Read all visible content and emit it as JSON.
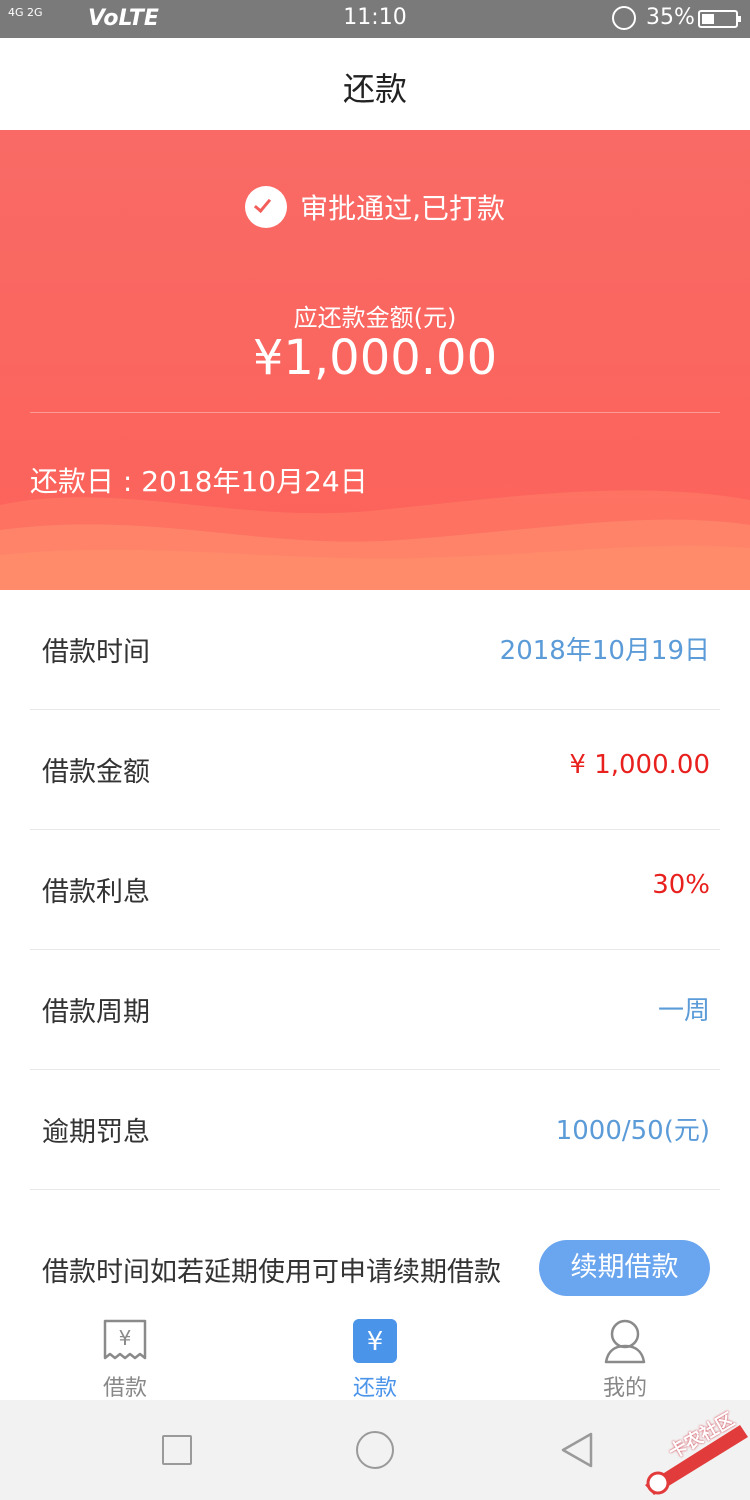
{
  "status_bar": {
    "signal": "4G 2G",
    "network": "VoLTE",
    "time": "11:10",
    "battery": "35%"
  },
  "header": {
    "title": "还款"
  },
  "hero": {
    "status_text": "审批通过,已打款",
    "amount_label": "应还款金额(元)",
    "amount_value": "¥1,000.00",
    "due_date": "还款日 : 2018年10月24日",
    "colors": {
      "top": "#f96a66",
      "bottom": "#fc6259",
      "wave": "#ff866b"
    }
  },
  "details": [
    {
      "label": "借款时间",
      "value": "2018年10月19日",
      "color": "#5b9bd8"
    },
    {
      "label": "借款金额",
      "value": "¥ 1,000.00",
      "color": "#e8201e"
    },
    {
      "label": "借款利息",
      "value": "30%",
      "color": "#e8201e"
    },
    {
      "label": "借款周期",
      "value": "一周",
      "color": "#5b9bd8"
    },
    {
      "label": "逾期罚息",
      "value": "1000/50(元)",
      "color": "#5b9bd8"
    }
  ],
  "renew": {
    "text": "借款时间如若延期使用可申请续期借款",
    "button": "续期借款"
  },
  "tabs": [
    {
      "label": "借款",
      "icon": "receipt-yen-icon",
      "active": false
    },
    {
      "label": "还款",
      "icon": "yen-icon",
      "active": true
    },
    {
      "label": "我的",
      "icon": "user-icon",
      "active": false
    }
  ],
  "navbar": {
    "icons": [
      "recent-apps-icon",
      "home-icon",
      "back-icon"
    ]
  },
  "watermark": {
    "text": "卡农社区"
  }
}
